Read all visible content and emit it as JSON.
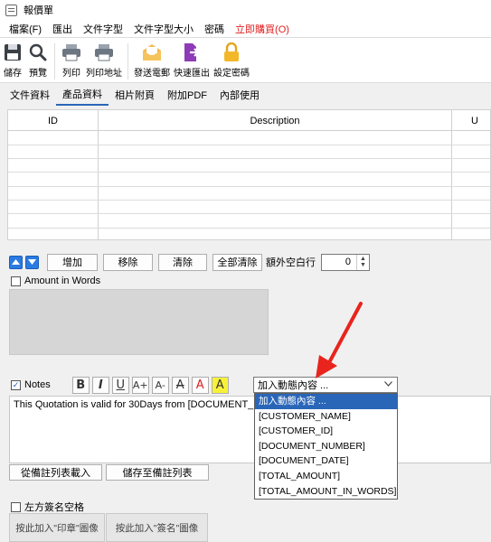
{
  "window": {
    "title": "報價單"
  },
  "menu": [
    "檔案(F)",
    "匯出",
    "文件字型",
    "文件字型大小",
    "密碼",
    "立即購買(O)"
  ],
  "toolbar": {
    "items": [
      {
        "label": "儲存",
        "icon": "floppy-icon"
      },
      {
        "label": "預覽",
        "icon": "magnifier-icon"
      },
      {
        "label": "列印",
        "icon": "printer-icon"
      },
      {
        "label": "列印地址",
        "icon": "printer-icon"
      },
      {
        "label": "發送電郵",
        "icon": "envelope-icon"
      },
      {
        "label": "快速匯出",
        "icon": "export-icon"
      },
      {
        "label": "設定密碼",
        "icon": "padlock-icon"
      }
    ]
  },
  "tabs": [
    "文件資料",
    "產品資料",
    "相片附頁",
    "附加PDF",
    "內部使用"
  ],
  "active_tab": 1,
  "grid": {
    "headers": [
      "ID",
      "Description",
      "U"
    ]
  },
  "actions": {
    "add": "增加",
    "remove": "移除",
    "clear": "清除",
    "clear_all": "全部清除",
    "extra_lines_label": "額外空白行",
    "extra_lines_value": "0"
  },
  "amount_in_words": {
    "label": "Amount in Words",
    "checked": false
  },
  "notes": {
    "label": "Notes",
    "checked": true,
    "format_buttons": [
      "B",
      "I",
      "U",
      "A+",
      "A-",
      "A",
      "A",
      "A"
    ],
    "text": "This Quotation is valid for 30Days from [DOCUMENT_DATE]"
  },
  "combo": {
    "value": "加入動態內容 ...",
    "options": [
      "加入動態內容 ...",
      "[CUSTOMER_NAME]",
      "[CUSTOMER_ID]",
      "[DOCUMENT_NUMBER]",
      "[DOCUMENT_DATE]",
      "[TOTAL_AMOUNT]",
      "[TOTAL_AMOUNT_IN_WORDS]"
    ]
  },
  "notes_buttons": {
    "load": "從備註列表載入",
    "save": "儲存至備註列表"
  },
  "signature": {
    "label": "左方簽名空格",
    "checked": false,
    "stamp_button": "按此加入\"印章\"圖像",
    "sign_button": "按此加入\"簽名\"圖像"
  },
  "colors": {
    "accent": "#2a66b8",
    "buy": "#e02020",
    "arrow": "#e8241c"
  }
}
